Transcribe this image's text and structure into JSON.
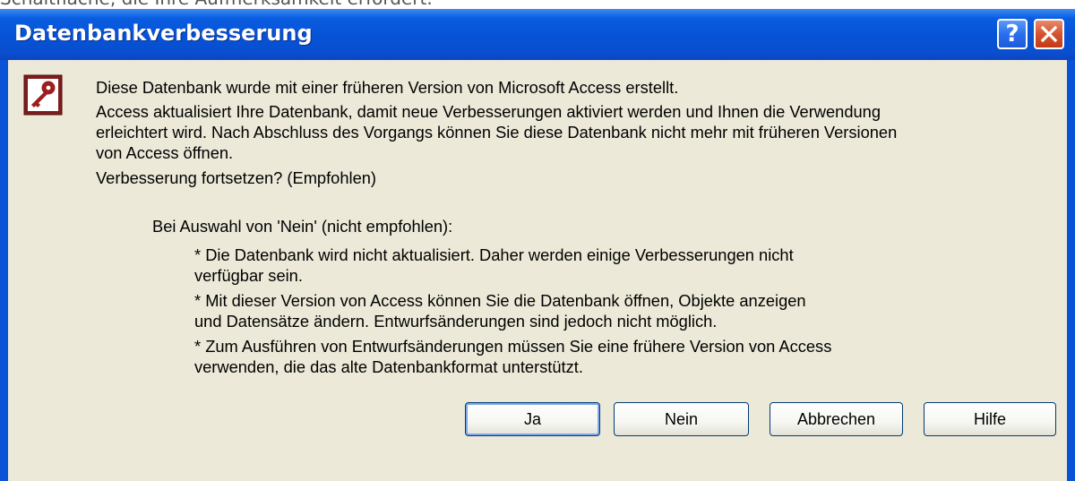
{
  "top_strip_text": "Schaltfläche, die Ihre Aufmerksamkeit erfordert.",
  "dialog": {
    "title": "Datenbankverbesserung",
    "help_button": "?",
    "messages": {
      "line1": "Diese Datenbank wurde mit einer früheren Version von Microsoft Access erstellt.",
      "line2a": "Access aktualisiert Ihre Datenbank, damit neue Verbesserungen aktiviert werden und Ihnen die Verwendung",
      "line2b": "erleichtert wird. Nach Abschluss des Vorgangs können Sie diese Datenbank nicht mehr mit früheren Versionen",
      "line2c": "von Access öffnen.",
      "line3": "Verbesserung fortsetzen? (Empfohlen)",
      "line4": "Bei Auswahl von 'Nein' (nicht empfohlen):",
      "bullet1a": "* Die Datenbank wird nicht aktualisiert. Daher werden einige Verbesserungen nicht",
      "bullet1b": "verfügbar sein.",
      "bullet2a": "* Mit dieser Version von Access können Sie die Datenbank öffnen, Objekte anzeigen",
      "bullet2b": "und Datensätze ändern. Entwurfsänderungen sind jedoch nicht möglich.",
      "bullet3a": "* Zum Ausführen von Entwurfsänderungen müssen Sie eine frühere Version von Access",
      "bullet3b": "verwenden, die das alte Datenbankformat unterstützt."
    },
    "buttons": {
      "yes": "Ja",
      "no": "Nein",
      "cancel": "Abbrechen",
      "help": "Hilfe"
    }
  },
  "colors": {
    "titlebar": "#0652d6",
    "window_bg": "#ece9d8",
    "close_button": "#d6532e",
    "icon_maroon": "#7f1c1c"
  },
  "icons": [
    "access-key-icon",
    "help-icon",
    "close-icon"
  ]
}
